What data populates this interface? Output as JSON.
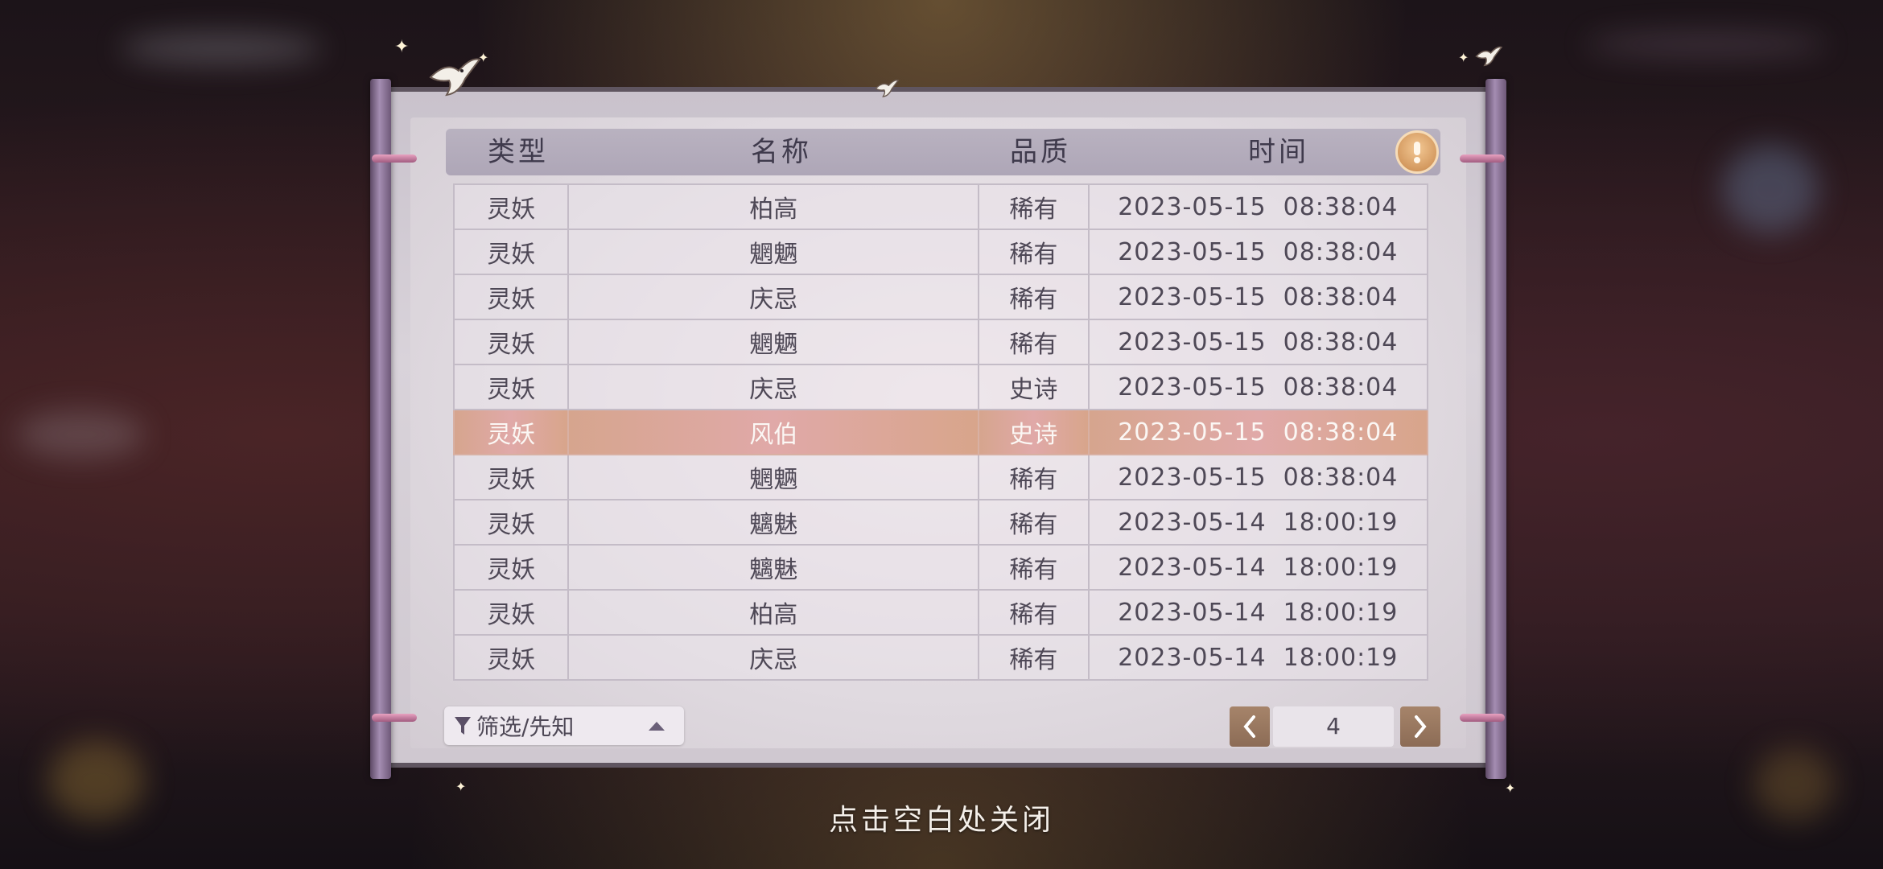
{
  "header": {
    "columns": [
      "类型",
      "名称",
      "品质",
      "时间"
    ]
  },
  "colors": {
    "rare": "#8f4fd0",
    "epic": "#c99410",
    "highlight_row": "#dca79a"
  },
  "rows": [
    {
      "type": "灵妖",
      "name": "柏高",
      "quality": "稀有",
      "quality_level": "rare",
      "time": "2023-05-15  08:38:04"
    },
    {
      "type": "灵妖",
      "name": "魍魉",
      "quality": "稀有",
      "quality_level": "rare",
      "time": "2023-05-15  08:38:04"
    },
    {
      "type": "灵妖",
      "name": "庆忌",
      "quality": "稀有",
      "quality_level": "rare",
      "time": "2023-05-15  08:38:04"
    },
    {
      "type": "灵妖",
      "name": "魍魉",
      "quality": "稀有",
      "quality_level": "rare",
      "time": "2023-05-15  08:38:04"
    },
    {
      "type": "灵妖",
      "name": "庆忌",
      "quality": "史诗",
      "quality_level": "epic",
      "time": "2023-05-15  08:38:04"
    },
    {
      "type": "灵妖",
      "name": "风伯",
      "quality": "史诗",
      "quality_level": "epic",
      "time": "2023-05-15  08:38:04",
      "highlight": true
    },
    {
      "type": "灵妖",
      "name": "魍魉",
      "quality": "稀有",
      "quality_level": "rare",
      "time": "2023-05-15  08:38:04"
    },
    {
      "type": "灵妖",
      "name": "魑魅",
      "quality": "稀有",
      "quality_level": "rare",
      "time": "2023-05-14  18:00:19"
    },
    {
      "type": "灵妖",
      "name": "魑魅",
      "quality": "稀有",
      "quality_level": "rare",
      "time": "2023-05-14  18:00:19"
    },
    {
      "type": "灵妖",
      "name": "柏高",
      "quality": "稀有",
      "quality_level": "rare",
      "time": "2023-05-14  18:00:19"
    },
    {
      "type": "灵妖",
      "name": "庆忌",
      "quality": "稀有",
      "quality_level": "rare",
      "time": "2023-05-14  18:00:19"
    }
  ],
  "filter": {
    "label": "筛选/先知",
    "filter_icon": "filter-funnel-icon",
    "toggle_icon": "triangle-up-icon"
  },
  "pager": {
    "page": "4",
    "prev_icon": "chevron-left-icon",
    "next_icon": "chevron-right-icon"
  },
  "hint_icon": "exclamation-icon",
  "close_hint": "点击空白处关闭"
}
